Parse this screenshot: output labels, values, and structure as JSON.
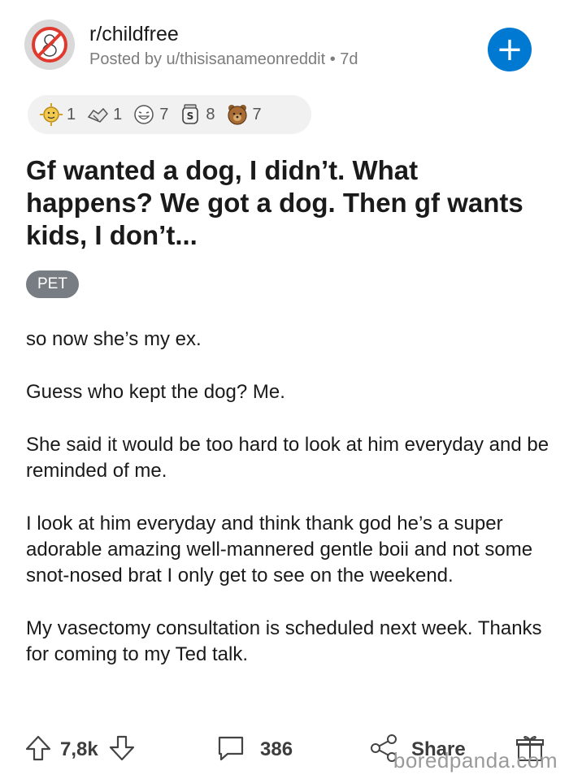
{
  "header": {
    "subreddit": "r/childfree",
    "posted_by": "Posted by u/thisisanameonreddit • 7d",
    "join_label": "+"
  },
  "awards": [
    {
      "icon": "sun-face-icon",
      "count": "1"
    },
    {
      "icon": "handshake-icon",
      "count": "1"
    },
    {
      "icon": "laughing-face-icon",
      "count": "7"
    },
    {
      "icon": "jar-icon",
      "count": "8"
    },
    {
      "icon": "bear-icon",
      "count": "7"
    }
  ],
  "post": {
    "title": "Gf wanted a dog, I didn’t. What happens? We got a dog. Then gf wants kids, I don’t...",
    "flair": "PET",
    "paragraphs": [
      "so now she’s my ex.",
      "Guess who kept the dog? Me.",
      "She said it would be too hard to look at him everyday and be reminded of me.",
      "I look at him everyday and think thank god he’s a super adorable amazing well-mannered gentle boii and not some snot-nosed brat I only get to see on the weekend.",
      "My vasectomy consultation is scheduled next week. Thanks for coming to my Ted talk."
    ]
  },
  "footer": {
    "votes": "7,8k",
    "comments": "386",
    "share": "Share"
  },
  "watermark": "boredpanda.com",
  "colors": {
    "accent": "#0079d3",
    "flair_bg": "#777d82"
  }
}
